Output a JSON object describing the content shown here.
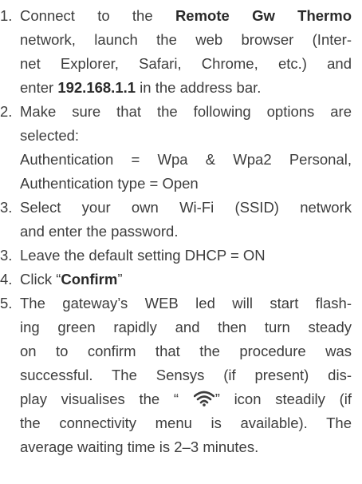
{
  "steps": [
    {
      "number": "1.",
      "lines": [
        {
          "pre": "Connect to the ",
          "bold": "Remote Gw Thermo",
          "post": ""
        },
        {
          "pre": "network, launch the web browser (Inter-",
          "bold": "",
          "post": ""
        },
        {
          "pre": "net Explorer, Safari, Chrome, etc.) and",
          "bold": "",
          "post": ""
        },
        {
          "pre": "enter ",
          "bold": "192.168.1.1",
          "post": " in the address bar."
        }
      ]
    },
    {
      "number": "2.",
      "lines": [
        "Make sure that the following options are",
        "selected:",
        "Authentication = Wpa & Wpa2 Personal,",
        "Authentication type = Open"
      ]
    },
    {
      "number": "3.",
      "lines": [
        "Select your own Wi-Fi (SSID) network",
        "and enter the password."
      ]
    },
    {
      "number": "3.",
      "lines": [
        "Leave the default setting DHCP = ON"
      ]
    },
    {
      "number": "4.",
      "click_pre": "Click “",
      "click_bold": "Confirm",
      "click_post": "”"
    },
    {
      "number": "5.",
      "lines": [
        "The gateway’s WEB led will start flash-",
        "ing green rapidly and then turn steady",
        "on to confirm that the procedure was",
        "successful.  The Sensys (if present) dis-"
      ],
      "icon_line_pre": "play visualises the “ ",
      "icon_name": "wifi-icon",
      "icon_line_post": "” icon steadily (if",
      "tail_lines": [
        "the connectivity menu is available). The",
        "average waiting time is 2–3 minutes."
      ]
    }
  ]
}
